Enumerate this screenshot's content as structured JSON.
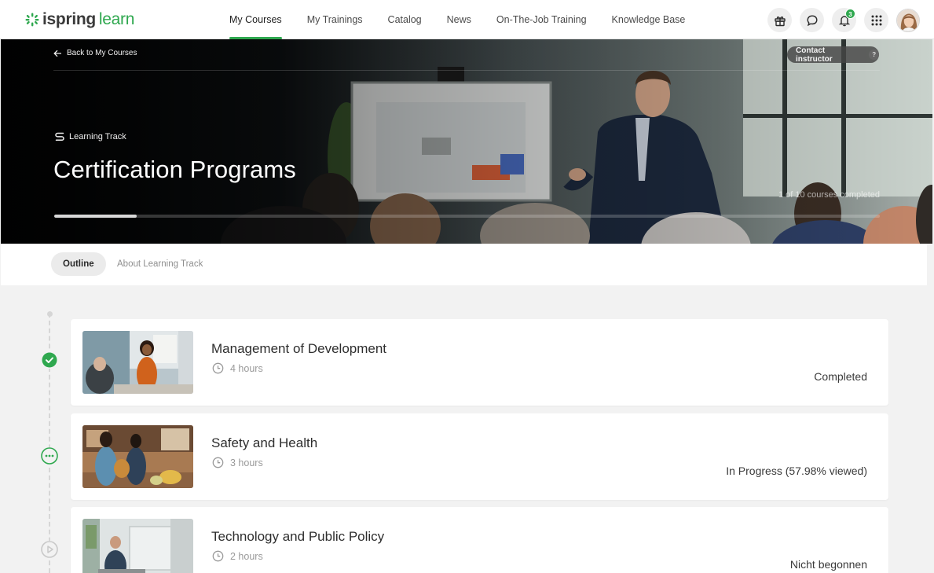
{
  "brand": {
    "name_part1": "ispring",
    "name_part2": "learn",
    "accent_color": "#2fa84f"
  },
  "nav": {
    "items": [
      "My Courses",
      "My Trainings",
      "Catalog",
      "News",
      "On-The-Job Training",
      "Knowledge Base"
    ],
    "active_index": 0,
    "notification_count": "3",
    "icons": [
      "gift-icon",
      "chat-icon",
      "bell-icon",
      "apps-grid-icon",
      "user-avatar"
    ]
  },
  "hero": {
    "back_label": "Back to My Courses",
    "contact_label": "Contact instructor",
    "help_glyph": "?",
    "type_label": "Learning Track",
    "title": "Certification Programs",
    "progress_text": "1 of 10 courses completed",
    "progress_fraction": 0.1
  },
  "tabs": {
    "items": [
      "Outline",
      "About Learning Track"
    ],
    "active_index": 0
  },
  "courses": [
    {
      "title": "Management of Development",
      "duration": "4 hours",
      "status": "Completed",
      "state": "completed"
    },
    {
      "title": "Safety and Health",
      "duration": "3 hours",
      "status": "In Progress (57.98% viewed)",
      "state": "in-progress"
    },
    {
      "title": "Technology and Public Policy",
      "duration": "2 hours",
      "status": "Nicht begonnen",
      "state": "not-started"
    }
  ]
}
